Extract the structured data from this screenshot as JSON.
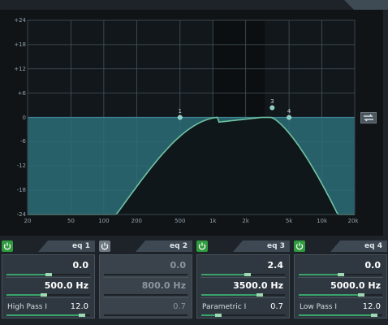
{
  "graph": {
    "y_ticks": [
      "+24",
      "+18",
      "+12",
      "+6",
      "0",
      "-6",
      "-12",
      "-18",
      "-24"
    ],
    "x_ticks": [
      "20",
      "50",
      "100",
      "200",
      "500",
      "1k",
      "2k",
      "5k",
      "10k",
      "20k"
    ],
    "band_markers": [
      {
        "label": "1",
        "freq": 500,
        "gain": 0
      },
      {
        "label": "3",
        "freq": 3500,
        "gain": 2.4
      },
      {
        "label": "4",
        "freq": 5000,
        "gain": 0
      }
    ],
    "colors": {
      "fill": "#2d6d78",
      "curve": "#6fc3a1",
      "grid": "#46545c",
      "zero_band": "#3d8490"
    }
  },
  "link_button": {
    "icon": "link-arrows-icon"
  },
  "bands": [
    {
      "name": "eq 1",
      "enabled": true,
      "gain": "0.0",
      "freq": "500.0 Hz",
      "type": "High Pass I",
      "q": "12.0",
      "gain_level": 0.5,
      "freq_level": 0.45,
      "q_level": 0.9
    },
    {
      "name": "eq 2",
      "enabled": false,
      "gain": "0.0",
      "freq": "800.0 Hz",
      "type": "",
      "q": "0.7",
      "gain_level": 0.5,
      "freq_level": 0.5,
      "q_level": 0.2
    },
    {
      "name": "eq 3",
      "enabled": true,
      "gain": "2.4",
      "freq": "3500.0 Hz",
      "type": "Parametric I",
      "q": "0.7",
      "gain_level": 0.55,
      "freq_level": 0.7,
      "q_level": 0.2
    },
    {
      "name": "eq 4",
      "enabled": true,
      "gain": "0.0",
      "freq": "5000.0 Hz",
      "type": "Low Pass I",
      "q": "12.0",
      "gain_level": 0.5,
      "freq_level": 0.75,
      "q_level": 0.9
    }
  ]
}
